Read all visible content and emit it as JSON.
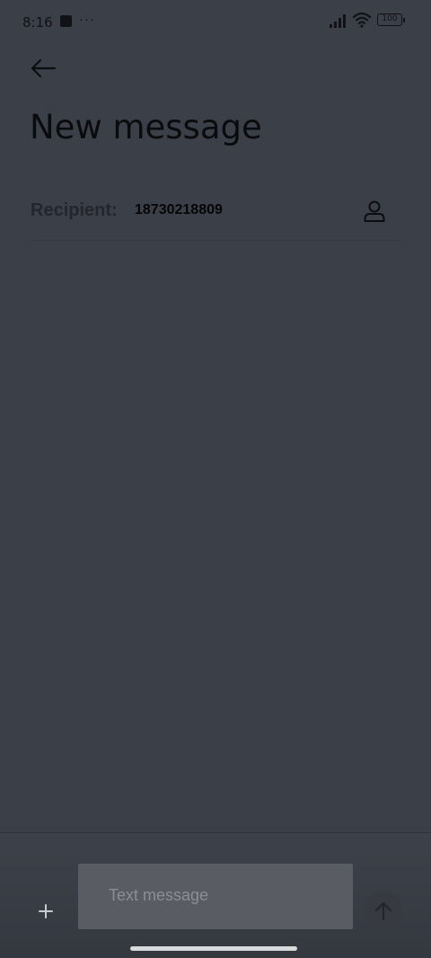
{
  "status_bar": {
    "time": "8:16",
    "dots": "···",
    "battery": "100",
    "icons": [
      "app-notification-icon",
      "signal-icon",
      "wifi-icon",
      "battery-icon"
    ]
  },
  "header": {
    "back_icon": "arrow-left-icon",
    "title": "New message"
  },
  "recipient": {
    "label": "Recipient:",
    "value": "18730218809",
    "contact_icon": "person-icon"
  },
  "composer": {
    "attach_icon": "plus-icon",
    "placeholder": "Text message",
    "value": "",
    "send_icon": "arrow-up-icon"
  },
  "colors": {
    "background": "#3b3f47",
    "text_field": "#595c63",
    "title": "#0a0b0d",
    "label": "#23262c"
  }
}
